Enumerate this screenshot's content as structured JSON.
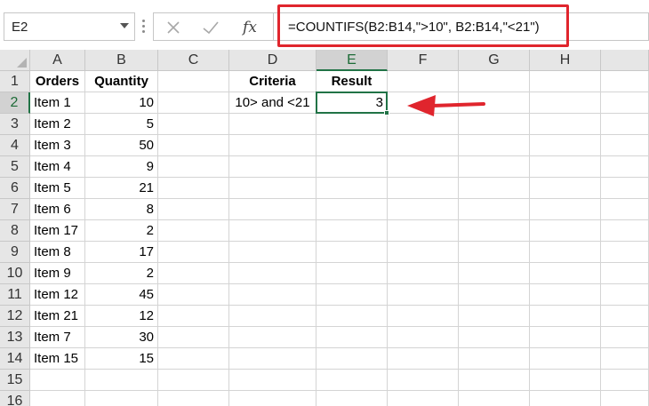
{
  "name_box": {
    "value": "E2"
  },
  "formula_bar": {
    "cancel_icon": "x-icon",
    "enter_icon": "check-icon",
    "fx_label": "fx",
    "formula": "=COUNTIFS(B2:B14,\">10\", B2:B14,\"<21\")"
  },
  "columns": [
    "A",
    "B",
    "C",
    "D",
    "E",
    "F",
    "G",
    "H"
  ],
  "rows": [
    "1",
    "2",
    "3",
    "4",
    "5",
    "6",
    "7",
    "8",
    "9",
    "10",
    "11",
    "12",
    "13",
    "14",
    "15",
    "16"
  ],
  "active_cell": "E2",
  "cells": {
    "A1": "Orders",
    "B1": "Quantity",
    "D1": "Criteria",
    "E1": "Result",
    "A2": "Item 1",
    "B2": "10",
    "D2": "10> and <21",
    "E2": "3",
    "A3": "Item 2",
    "B3": "5",
    "A4": "Item 3",
    "B4": "50",
    "A5": "Item 4",
    "B5": "9",
    "A6": "Item 5",
    "B6": "21",
    "A7": "Item 6",
    "B7": "8",
    "A8": "Item 17",
    "B8": "2",
    "A9": "Item 8",
    "B9": "17",
    "A10": "Item 9",
    "B10": "2",
    "A11": "Item 12",
    "B11": "45",
    "A12": "Item 21",
    "B12": "12",
    "A13": "Item 7",
    "B13": "30",
    "A14": "Item 15",
    "B14": "15"
  },
  "colors": {
    "accent": "#217346",
    "highlight": "#e0252d"
  }
}
